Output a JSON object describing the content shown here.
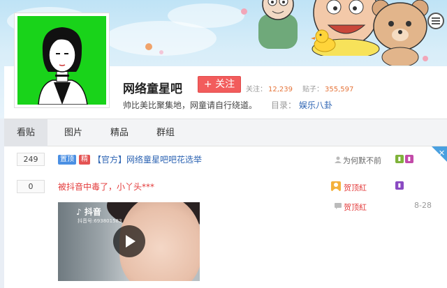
{
  "forum": {
    "name": "网络童星吧",
    "follow_label": "+ 关注",
    "follow_count_label": "关注：",
    "follow_count": "12,239",
    "post_count_label": "贴子：",
    "post_count": "355,597",
    "slogan": "帅比美比聚集地，网童请自行绕道。",
    "category_label": "目录：",
    "category": "娱乐八卦"
  },
  "tabs": [
    {
      "label": "看贴",
      "active": true
    },
    {
      "label": "图片",
      "active": false
    },
    {
      "label": "精品",
      "active": false
    },
    {
      "label": "群组",
      "active": false
    }
  ],
  "threads": [
    {
      "reply_count": "249",
      "badges": [
        "置顶",
        "精"
      ],
      "title": "【官方】网络童星吧吧花选举",
      "author": "为何默不前",
      "author_icons": [
        "user-icon",
        "level-icon"
      ]
    },
    {
      "reply_count": "0",
      "badges": [],
      "title": "被抖音中毒了，小丫头***",
      "author": "贺顶紅",
      "last_reply_author": "贺顶紅",
      "date": "8-28",
      "video": {
        "brand": "抖音",
        "id_text": "抖音号:693801583"
      }
    }
  ],
  "colors": {
    "avatar_bg": "#19d31a",
    "follow_button": "#f25c5c",
    "link_blue": "#2d64b3",
    "hot_red": "#e33a3a"
  }
}
